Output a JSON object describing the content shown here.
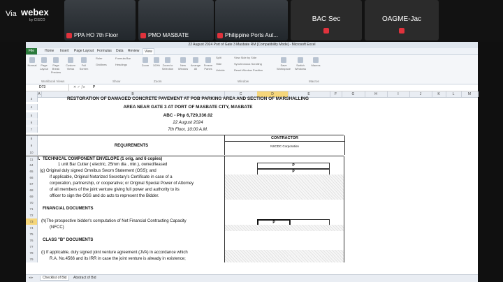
{
  "webex": {
    "via": "Via",
    "brand": "webex",
    "by": "by CISCO"
  },
  "tiles": [
    {
      "name": "PPA HO 7th Floor"
    },
    {
      "name": "PMO MASBATE"
    },
    {
      "name": "Philippine Ports Aut..."
    },
    {
      "name": "BAC Sec"
    },
    {
      "name": "OAGME-Jac"
    }
  ],
  "excel": {
    "window_title": "22 August 2024 Port of Gate 3 Masbate RM  [Compatibility Mode]  -  Microsoft Excel",
    "tabs": [
      "File",
      "Home",
      "Insert",
      "Page Layout",
      "Formulas",
      "Data",
      "Review",
      "View"
    ],
    "active_tab": "View",
    "ribbon_groups": [
      "Workbook Views",
      "Show",
      "Zoom",
      "Window",
      "Macros"
    ],
    "ribbon_buttons": {
      "normal": "Normal",
      "page_layout": "Page Layout",
      "page_break": "Page Break Preview",
      "custom_views": "Custom Views",
      "full_screen": "Full Screen",
      "ruler": "Ruler",
      "gridlines": "Gridlines",
      "formula_bar": "Formula Bar",
      "headings": "Headings",
      "zoom": "Zoom",
      "zoom100": "100%",
      "zoom_selection": "Zoom to Selection",
      "new_window": "New Window",
      "arrange_all": "Arrange All",
      "freeze_panes": "Freeze Panes",
      "split": "Split",
      "hide": "Hide",
      "unhide": "Unhide",
      "side_by_side": "View Side by Side",
      "sync_scroll": "Synchronous Scrolling",
      "reset_window": "Reset Window Position",
      "save_workspace": "Save Workspace",
      "switch_windows": "Switch Windows",
      "macros": "Macros"
    },
    "name_box": "D73",
    "formula_value": "P",
    "columns": [
      "A",
      "B",
      "C",
      "D",
      "E",
      "F",
      "G",
      "H",
      "I",
      "J",
      "K",
      "L",
      "M"
    ],
    "rows": {
      "r3": {
        "num": "3",
        "text": "RESTORATION OF DAMAGED CONCRETE PAVEMENT AT POB PARKING AREA AND SECTION OF MARSHALLING"
      },
      "r4": {
        "num": "4",
        "text": "AREA NEAR GATE 3 AT PORT OF MASBATE CITY, MASBATE"
      },
      "r5": {
        "num": "5",
        "text": "ABC - Php 6,729,336.02"
      },
      "r6": {
        "num": "6",
        "text": "22 August 2024"
      },
      "r7": {
        "num": "7",
        "text": "7th Floor, 10:00 A.M."
      },
      "r8": {
        "num": "8",
        "requirements": "REQUIREMENTS",
        "contractor": "CONTRACTOR"
      },
      "r9": {
        "num": "9",
        "bidder": "NSCDC Corporation"
      },
      "r10": {
        "num": "10"
      },
      "r11": {
        "num": "11",
        "label": "I.",
        "text": "TECHNICAL COMPONENT ENVELOPE      (1 orig, and 6 copies)"
      },
      "r64": {
        "num": "64",
        "text": "1  unit  Bar Cutter ( electric, 25mm dia , min.), owned/leased",
        "mark": "P"
      },
      "r65": {
        "num": "65",
        "text": "(g) Original duly signed Omnibus Sworn Statement (OSS); and",
        "mark": "P"
      },
      "r66": {
        "num": "66",
        "text": "if applicable, Original Notarized Secretary's Certificate in case of a"
      },
      "r67": {
        "num": "67",
        "text": "corporation, partnership, or cooperative; or Original Special Power of Attorney"
      },
      "r68": {
        "num": "68",
        "text": "of  all members of the joint venture giving full power and authority to its"
      },
      "r69": {
        "num": "69",
        "text": "officer to sign the OSS and do acts to represent the Bidder."
      },
      "r70": {
        "num": "70"
      },
      "r71": {
        "num": "71",
        "text": "FINANCIAL DOCUMENTS"
      },
      "r72": {
        "num": "72"
      },
      "r73": {
        "num": "73",
        "text": "(h)The prospective bidder's computation of Net Financial Contracting Capacity",
        "mark": "P"
      },
      "r74": {
        "num": "74",
        "text": "(NFCC)"
      },
      "r75": {
        "num": "75"
      },
      "r76": {
        "num": "76",
        "text": "CLASS \"B\" DOCUMENTS"
      },
      "r77": {
        "num": "77"
      },
      "r78": {
        "num": "78",
        "text": "(i) If applicable, duly signed joint venture agreement (JVA) in accordance which"
      },
      "r79": {
        "num": "79",
        "text": "R.A. No.4566 and its IRR in case the joint venture is already in existence;"
      }
    },
    "sheet_tabs": [
      "Checklist of Bid",
      "Abstract of Bid"
    ]
  }
}
